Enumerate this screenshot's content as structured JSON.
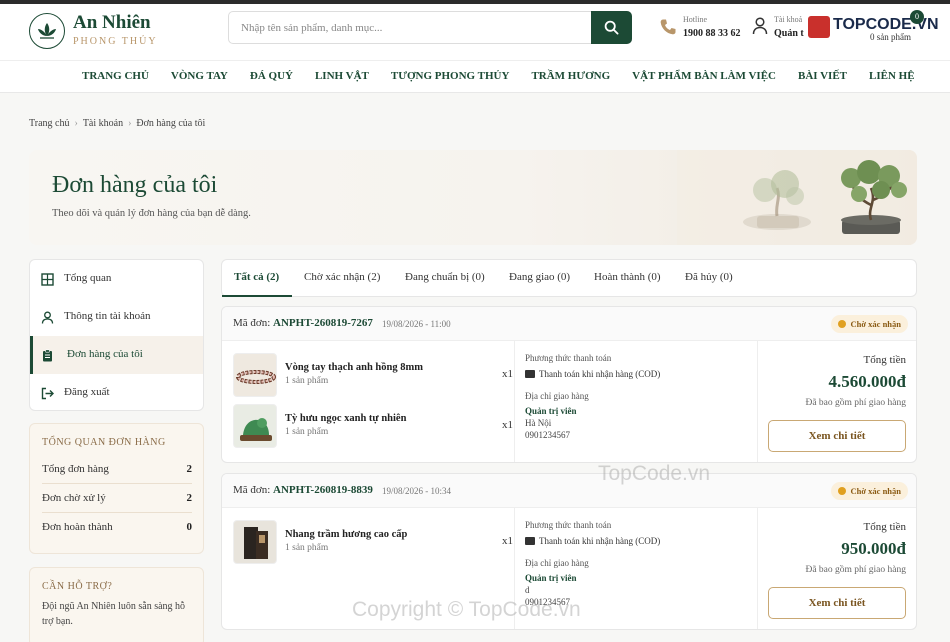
{
  "header": {
    "logo_name": "An Nhiên",
    "logo_sub": "PHONG THỦY",
    "search_placeholder": "Nhập tên sản phẩm, danh mục...",
    "hotline_label": "Hotline",
    "hotline_number": "1900 88 33 62",
    "account_label": "Tài khoả",
    "account_value": "Quản t",
    "cart_count": "0",
    "cart_sub": "0 sản phẩm",
    "brand_tag": "TOPCODE.VN"
  },
  "nav": [
    "TRANG CHỦ",
    "VÒNG TAY",
    "ĐÁ QUÝ",
    "LINH VẬT",
    "TƯỢNG PHONG THỦY",
    "TRẦM HƯƠNG",
    "VẬT PHẨM BÀN LÀM VIỆC",
    "BÀI VIẾT",
    "LIÊN HỆ"
  ],
  "breadcrumb": [
    "Trang chủ",
    "Tài khoản",
    "Đơn hàng của tôi"
  ],
  "hero": {
    "title": "Đơn hàng của tôi",
    "subtitle": "Theo dõi và quản lý đơn hàng của bạn dễ dàng."
  },
  "sidebar": [
    {
      "label": "Tổng quan",
      "icon": "grid-icon"
    },
    {
      "label": "Thông tin tài khoản",
      "icon": "user-icon"
    },
    {
      "label": "Đơn hàng của tôi",
      "icon": "clipboard-icon",
      "active": true
    },
    {
      "label": "Đăng xuất",
      "icon": "logout-icon"
    }
  ],
  "summary": {
    "title": "TỔNG QUAN ĐƠN HÀNG",
    "rows": [
      {
        "label": "Tổng đơn hàng",
        "value": "2"
      },
      {
        "label": "Đơn chờ xử lý",
        "value": "2"
      },
      {
        "label": "Đơn hoàn thành",
        "value": "0"
      }
    ]
  },
  "support": {
    "title": "CẦN HỖ TRỢ?",
    "text": "Đội ngũ An Nhiên luôn sẵn sàng hỗ trợ bạn."
  },
  "tabs": [
    "Tất cả (2)",
    "Chờ xác nhận (2)",
    "Đang chuẩn bị (0)",
    "Đang giao (0)",
    "Hoàn thành (0)",
    "Đã hủy (0)"
  ],
  "orders": [
    {
      "code_label": "Mã đơn:",
      "code": "ANPHT-260819-7267",
      "date": "19/08/2026 - 11:00",
      "status": "Chờ xác nhận",
      "items": [
        {
          "name": "Vòng tay thạch anh hồng 8mm",
          "qty": "1 sản phẩm",
          "x": "x1"
        },
        {
          "name": "Tỳ hưu ngọc xanh tự nhiên",
          "qty": "1 sản phẩm",
          "x": "x1"
        }
      ],
      "pay_title": "Phương thức thanh toán",
      "pay_method": "Thanh toán khi nhận hàng (COD)",
      "addr_title": "Địa chỉ giao hàng",
      "recipient": "Quản trị viên",
      "addr_line": "Hà Nội",
      "phone": "0901234567",
      "total_label": "Tổng tiền",
      "total": "4.560.000đ",
      "total_note": "Đã bao gồm phí giao hàng",
      "button": "Xem chi tiết"
    },
    {
      "code_label": "Mã đơn:",
      "code": "ANPHT-260819-8839",
      "date": "19/08/2026 - 10:34",
      "status": "Chờ xác nhận",
      "items": [
        {
          "name": "Nhang trầm hương cao cấp",
          "qty": "1 sản phẩm",
          "x": "x1"
        }
      ],
      "pay_title": "Phương thức thanh toán",
      "pay_method": "Thanh toán khi nhận hàng (COD)",
      "addr_title": "Địa chỉ giao hàng",
      "recipient": "Quản trị viên",
      "addr_line": "d",
      "phone": "0901234567",
      "total_label": "Tổng tiền",
      "total": "950.000đ",
      "total_note": "Đã bao gồm phí giao hàng",
      "button": "Xem chi tiết"
    }
  ],
  "watermarks": [
    "TopCode.vn",
    "Copyright © TopCode.vn"
  ],
  "colors": {
    "primary": "#1c4a35",
    "accent": "#b8966a",
    "badge_bg": "#fbf0dc"
  }
}
